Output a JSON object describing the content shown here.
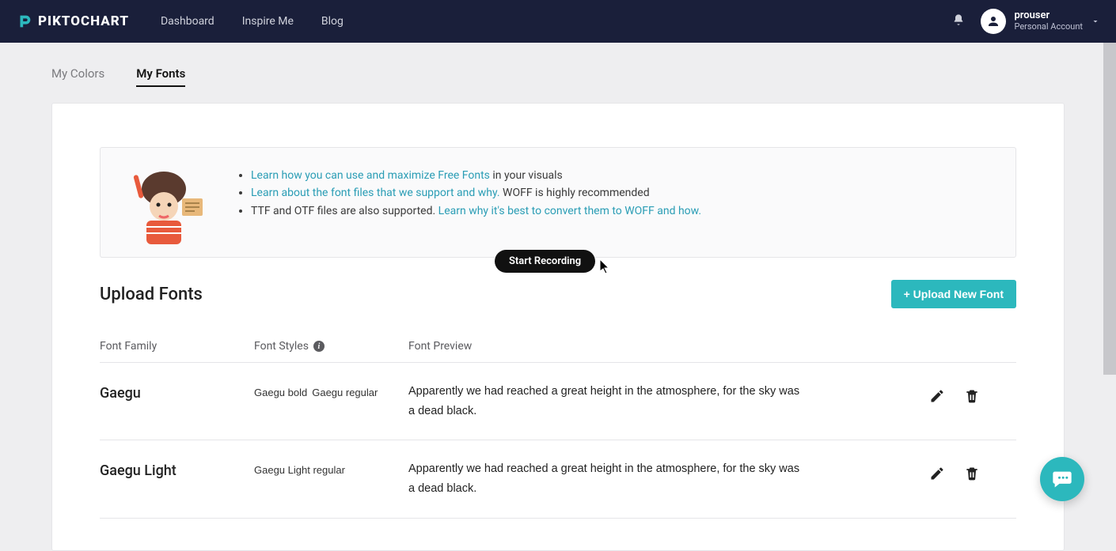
{
  "nav": {
    "brand": "PIKTOCHART",
    "links": [
      "Dashboard",
      "Inspire Me",
      "Blog"
    ],
    "user_name": "prouser",
    "user_account": "Personal Account"
  },
  "tabs": {
    "colors": "My Colors",
    "fonts": "My Fonts"
  },
  "info": {
    "line1_link": "Learn how you can use and maximize Free Fonts",
    "line1_rest": " in your visuals",
    "line2_link": "Learn about the font files that we support and why.",
    "line2_rest": " WOFF is highly recommended",
    "line3_pre": "TTF and OTF files are also supported. ",
    "line3_link": "Learn why it's best to convert them to WOFF and how."
  },
  "section": {
    "title": "Upload Fonts",
    "upload_btn": "+ Upload New Font"
  },
  "columns": {
    "family": "Font Family",
    "styles": "Font Styles",
    "preview": "Font Preview"
  },
  "fonts": [
    {
      "family": "Gaegu",
      "style1": "Gaegu bold",
      "style2": "Gaegu regular",
      "preview": "Apparently we had reached a great height in the atmosphere, for the sky was a dead black."
    },
    {
      "family": "Gaegu Light",
      "style1": "Gaegu Light regular",
      "style2": "",
      "preview": "Apparently we had reached a great height in the atmosphere, for the sky was a dead black."
    }
  ],
  "tooltip": {
    "recording": "Start Recording"
  }
}
